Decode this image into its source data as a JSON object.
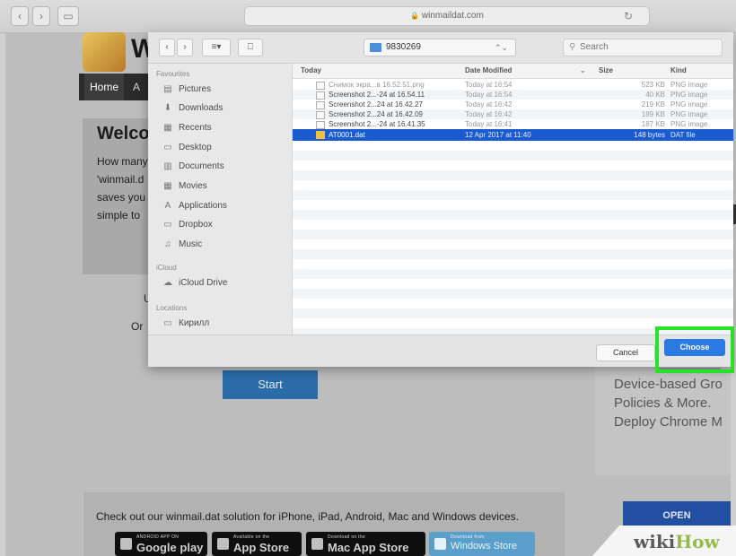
{
  "browser": {
    "url": "winmaildat.com",
    "url_lock": "🔒",
    "reload_icon": "↻",
    "back_icon": "‹",
    "forward_icon": "›",
    "sidebar_icon": "▭"
  },
  "site": {
    "logo_letter": "W",
    "nav_home": "Home",
    "nav_next": "A",
    "welcome_title": "Welco",
    "welcome_text": "How many\n'winmail.d\nsaves you\nsimple to ",
    "fragment_u": "U",
    "fragment_or": "Or",
    "start_label": "Start",
    "ad_text": "Device-based Gro\nPolicies & More.\nDeploy Chrome M",
    "footer_text": "Check out our winmail.dat solution for iPhone, iPad, Android, Mac and Windows devices.",
    "badges": [
      {
        "small": "ANDROID APP ON",
        "big": "Google play"
      },
      {
        "small": "Available on the",
        "big": "App Store"
      },
      {
        "small": "Download on the",
        "big": "Mac App Store"
      },
      {
        "small": "Download from",
        "big": "Windows Store"
      }
    ],
    "open_label": "OPEN",
    "wiki_prefix": "wiki",
    "wiki_suffix": "How"
  },
  "dialog": {
    "back": "‹",
    "forward": "›",
    "view_mode": "≡▾",
    "new_folder": "⎕",
    "location": "9830269",
    "location_arrows": "⌃⌄",
    "search_placeholder": "Search",
    "sidebar": {
      "favourites_heading": "Favourites",
      "icloud_heading": "iCloud",
      "locations_heading": "Locations",
      "items": [
        {
          "label": "Pictures",
          "icon": "▤"
        },
        {
          "label": "Downloads",
          "icon": "⬇"
        },
        {
          "label": "Recents",
          "icon": "▦"
        },
        {
          "label": "Desktop",
          "icon": "▭"
        },
        {
          "label": "Documents",
          "icon": "▥"
        },
        {
          "label": "Movies",
          "icon": "▦"
        },
        {
          "label": "Applications",
          "icon": "A"
        },
        {
          "label": "Dropbox",
          "icon": "▭"
        },
        {
          "label": "Music",
          "icon": "♫"
        }
      ],
      "icloud_item": {
        "label": "iCloud Drive",
        "icon": "☁"
      },
      "location_item": {
        "label": "Кирилл",
        "icon": "▭"
      }
    },
    "columns": {
      "name": "Today",
      "date": "Date Modified",
      "sort": "⌄",
      "size": "Size",
      "kind": "Kind"
    },
    "files": [
      {
        "name": "Снимок экра...в 16.52.51.png",
        "date": "Today at 16:54",
        "size": "523 KB",
        "kind": "PNG image"
      },
      {
        "name": "Screenshot 2...-24 at 16.54.11",
        "date": "Today at 16:54",
        "size": "40 KB",
        "kind": "PNG image"
      },
      {
        "name": "Screenshot 2...24 at 16.42.27",
        "date": "Today at 16:42",
        "size": "219 KB",
        "kind": "PNG image"
      },
      {
        "name": "Screenshot 2...24 at 16.42.09",
        "date": "Today at 16:42",
        "size": "189 KB",
        "kind": "PNG image"
      },
      {
        "name": "Screenshot 2...-24 at 16.41.35",
        "date": "Today at 16:41",
        "size": "187 KB",
        "kind": "PNG image"
      },
      {
        "name": "AT0001.dat",
        "date": "12 Apr 2017 at 11:40",
        "size": "148 bytes",
        "kind": "DAT file"
      }
    ],
    "cancel_label": "Cancel",
    "choose_label": "Choose"
  },
  "colors": {
    "selection": "#1a5ccf",
    "choose_button": "#2b7ae3",
    "highlight": "#27e22b"
  }
}
